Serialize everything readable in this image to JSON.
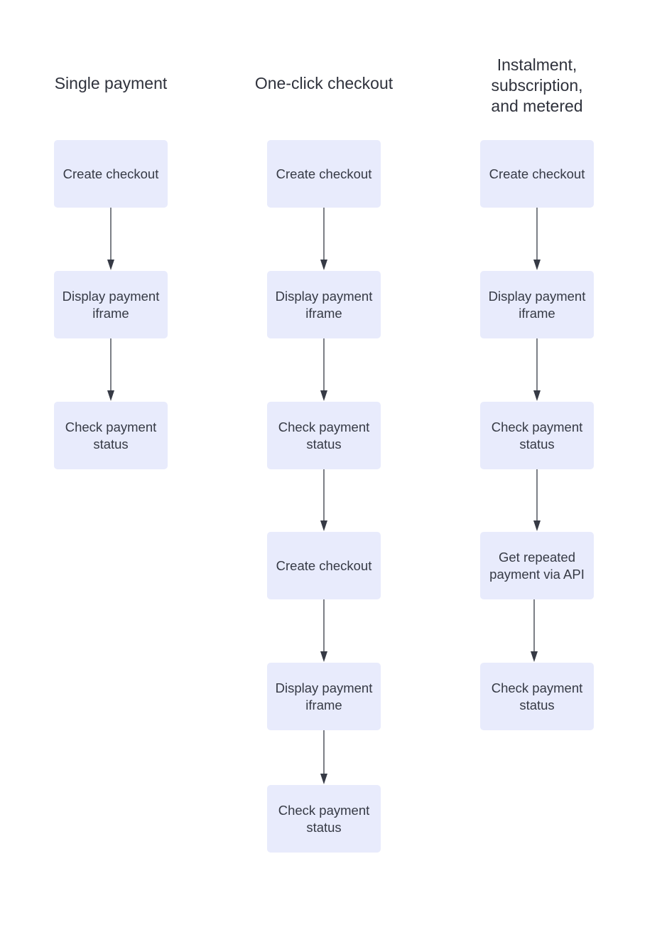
{
  "columns": [
    {
      "title": "Single payment",
      "steps": [
        "Create checkout",
        "Display payment iframe",
        "Check payment status"
      ]
    },
    {
      "title": "One-click checkout",
      "steps": [
        "Create checkout",
        "Display payment iframe",
        "Check payment status",
        "Create checkout",
        "Display payment iframe",
        "Check payment status"
      ]
    },
    {
      "title": "Instalment, subscription, and metered",
      "steps": [
        "Create checkout",
        "Display payment iframe",
        "Check payment status",
        "Get repeated payment via API",
        "Check payment status"
      ]
    }
  ],
  "colors": {
    "box_fill": "#e8ebfc",
    "arrow": "#363a45",
    "text": "#363a45"
  }
}
